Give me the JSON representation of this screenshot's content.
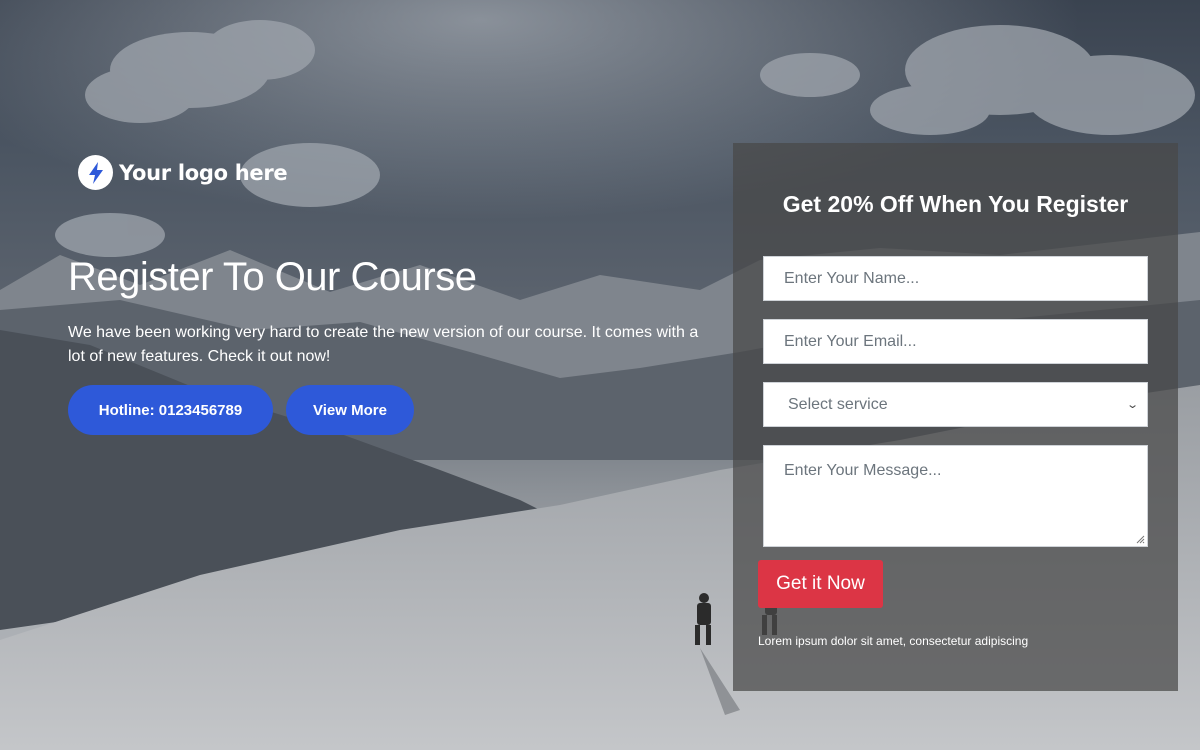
{
  "brand": {
    "logo_text": "Your logo here",
    "icon": "lightning-bolt-icon",
    "accent_color": "#2e59d9"
  },
  "hero": {
    "headline": "Register To Our Course",
    "description": "We have been working very hard to create the new version of our course. It comes with a lot of new features. Check it out now!",
    "hotline_button": "Hotline: 0123456789",
    "view_more_button": "View More"
  },
  "form": {
    "title": "Get 20% Off When You Register",
    "name_placeholder": "Enter Your Name...",
    "email_placeholder": "Enter Your Email...",
    "service_selected": "Select service",
    "message_placeholder": "Enter Your Message...",
    "submit_label": "Get it Now",
    "submit_color": "#dc3545",
    "footnote": "Lorem ipsum dolor sit amet, consectetur adipiscing"
  }
}
